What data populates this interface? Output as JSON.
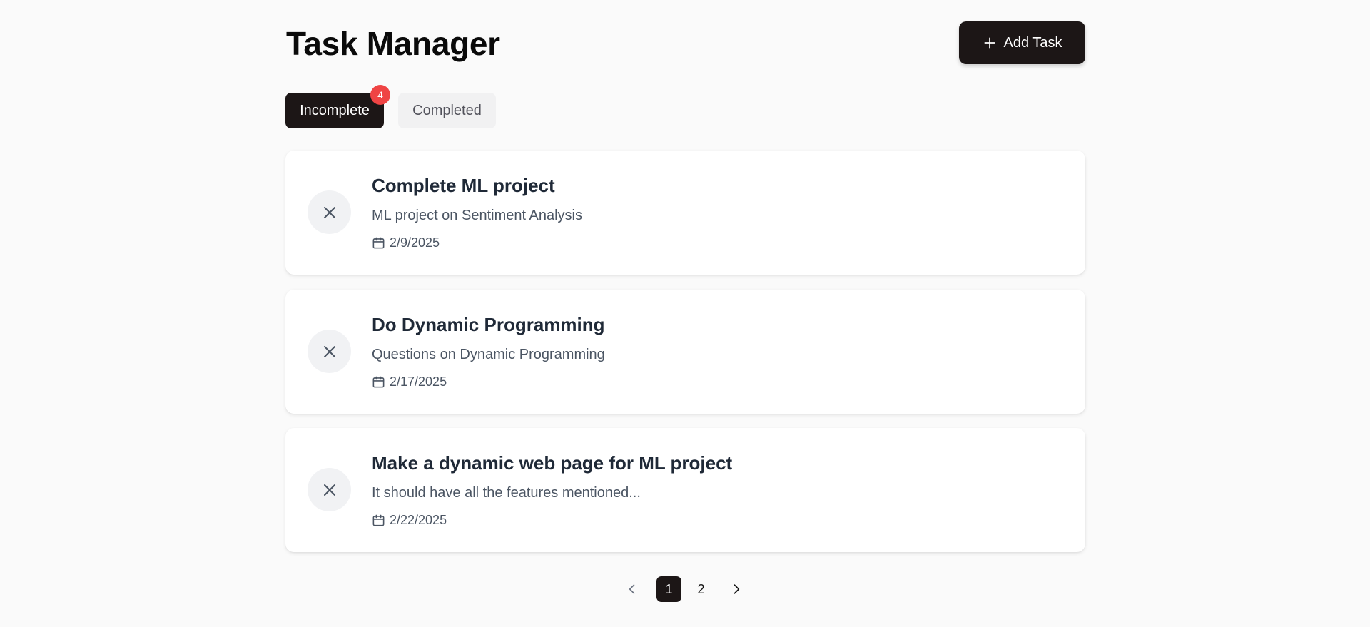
{
  "header": {
    "title": "Task Manager",
    "add_button_label": "Add Task",
    "add_icon": "plus-icon"
  },
  "tabs": [
    {
      "label": "Incomplete",
      "active": true,
      "badge": "4"
    },
    {
      "label": "Completed",
      "active": false
    }
  ],
  "tasks": [
    {
      "title": "Complete ML project",
      "description": "ML project on Sentiment Analysis",
      "date": "2/9/2025",
      "status_icon": "close-icon"
    },
    {
      "title": "Do Dynamic Programming",
      "description": "Questions on Dynamic Programming",
      "date": "2/17/2025",
      "status_icon": "close-icon"
    },
    {
      "title": "Make a dynamic web page for ML project",
      "description": "It should have all the features mentioned...",
      "date": "2/22/2025",
      "status_icon": "close-icon"
    }
  ],
  "pagination": {
    "pages": [
      "1",
      "2"
    ],
    "current": "1",
    "prev_icon": "chevron-left-icon",
    "next_icon": "chevron-right-icon"
  },
  "colors": {
    "primary": "#1c1616",
    "badge": "#ef4444",
    "background": "#fafafa",
    "card": "#ffffff"
  }
}
